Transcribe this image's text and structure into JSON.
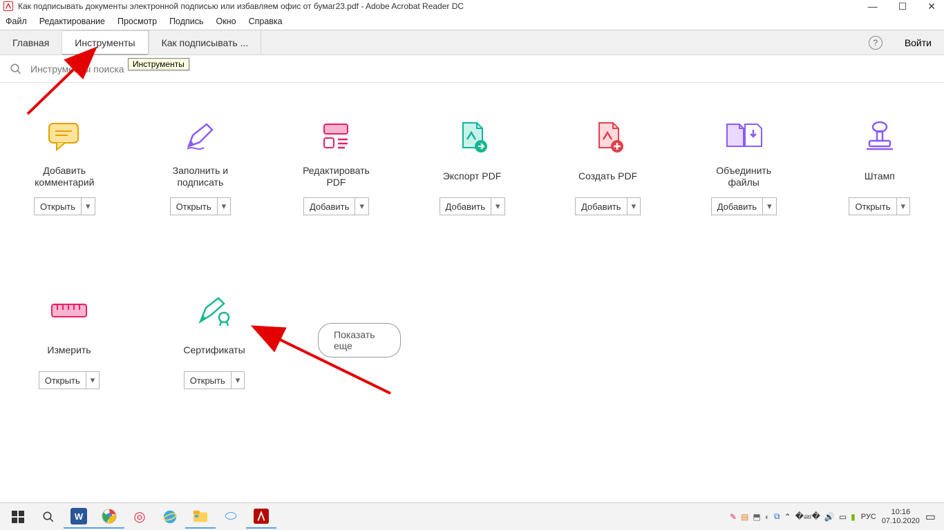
{
  "titlebar": {
    "title": "Как подписывать документы электронной подписью или избавляем офис от бумаг23.pdf - Adobe Acrobat Reader DC"
  },
  "menubar": {
    "items": [
      "Файл",
      "Редактирование",
      "Просмотр",
      "Подпись",
      "Окно",
      "Справка"
    ]
  },
  "toptabs": {
    "home": "Главная",
    "tools": "Инструменты",
    "doc": "Как подписывать ...",
    "login": "Войти"
  },
  "tooltip": "Инструменты",
  "search": {
    "placeholder": "Инструменты поиска"
  },
  "tools_row1": [
    {
      "label": "Добавить комментарий",
      "button": "Открыть"
    },
    {
      "label": "Заполнить и подписать",
      "button": "Открыть"
    },
    {
      "label": "Редактировать PDF",
      "button": "Добавить"
    },
    {
      "label": "Экспорт PDF",
      "button": "Добавить"
    },
    {
      "label": "Создать PDF",
      "button": "Добавить"
    },
    {
      "label": "Объединить файлы",
      "button": "Добавить"
    },
    {
      "label": "Штамп",
      "button": "Открыть"
    }
  ],
  "tools_row2": [
    {
      "label": "Измерить",
      "button": "Открыть"
    },
    {
      "label": "Сертификаты",
      "button": "Открыть"
    }
  ],
  "show_more": "Показать еще",
  "taskbar": {
    "lang": "РУС",
    "time": "10:16",
    "date": "07.10.2020"
  }
}
